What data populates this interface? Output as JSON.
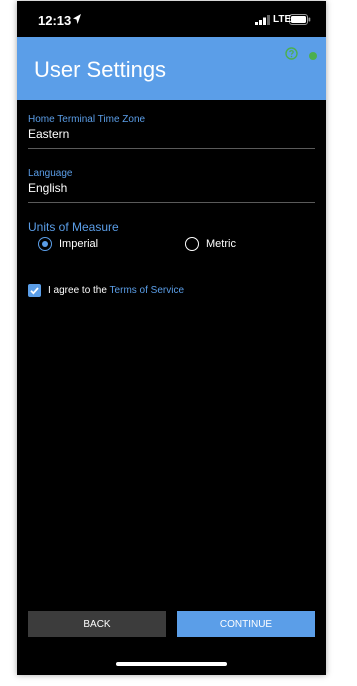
{
  "status_bar": {
    "time": "12:13",
    "network": "LTE"
  },
  "header": {
    "title": "User Settings",
    "accent_color": "#5b9ee8",
    "connection_status_color": "#4caf50",
    "help_icon": "help-circle-icon"
  },
  "fields": {
    "time_zone": {
      "label": "Home Terminal Time Zone",
      "value": "Eastern"
    },
    "language": {
      "label": "Language",
      "value": "English"
    }
  },
  "units": {
    "label": "Units of Measure",
    "options": [
      {
        "label": "Imperial",
        "selected": true
      },
      {
        "label": "Metric",
        "selected": false
      }
    ]
  },
  "agreement": {
    "checked": true,
    "text": "I agree to the",
    "link_text": "Terms of Service"
  },
  "buttons": {
    "back_label": "BACK",
    "continue_label": "CONTINUE"
  }
}
